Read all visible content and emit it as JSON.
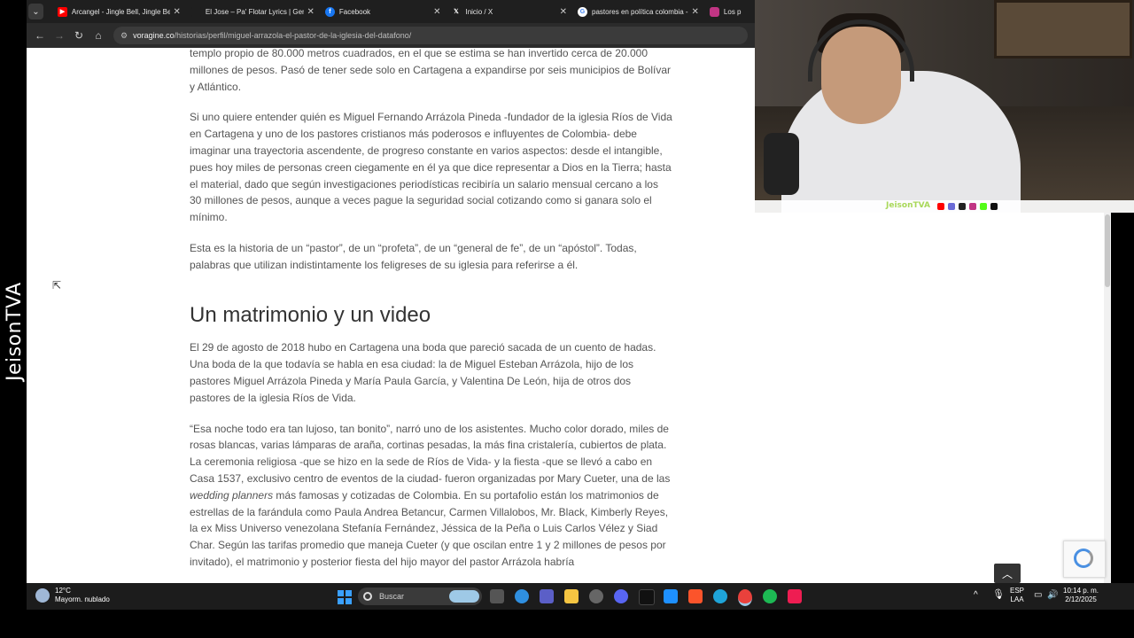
{
  "side_watermark": "JeisonTVA",
  "tabs": [
    {
      "title": "Arcangel - Jingle Bell, Jingle Be",
      "icon": "youtube-icon",
      "color": "#ff0000"
    },
    {
      "title": "El Jose – Pa' Flotar Lyrics | Geni",
      "icon": "genius-icon",
      "color": "#ffff64"
    },
    {
      "title": "Facebook",
      "icon": "facebook-icon",
      "color": "#1877f2"
    },
    {
      "title": "Inicio / X",
      "icon": "x-icon",
      "color": "#000000"
    },
    {
      "title": "pastores en política colombia -",
      "icon": "google-icon",
      "color": "#ffffff"
    },
    {
      "title": "Los p",
      "icon": "instagram-icon",
      "color": "#c13584"
    }
  ],
  "address_bar": {
    "domain": "voragine.co",
    "path": "/historias/perfil/miguel-arrazola-el-pastor-de-la-iglesia-del-datafono/"
  },
  "article": {
    "p0": "templo propio de 80.000 metros cuadrados, en el que se estima se han invertido cerca de 20.000 millones de pesos. Pasó de tener sede solo en Cartagena a expandirse por seis municipios de Bolívar y Atlántico.",
    "p1": "Si uno quiere entender quién es Miguel Fernando Arrázola Pineda -fundador de la iglesia Ríos de Vida en Cartagena y uno de los pastores cristianos más poderosos e influyentes de Colombia- debe imaginar una trayectoria ascendente, de progreso constante en varios aspectos: desde el intangible, pues hoy miles de personas creen ciegamente en él ya que dice representar a Dios en la Tierra; hasta el material, dado que según investigaciones periodísticas recibiría un salario mensual cercano a los 30 millones de pesos, aunque a veces pague la seguridad social cotizando como si ganara solo el mínimo.",
    "p2": "Esta es la historia de un “pastor”, de un “profeta”, de un “general de fe”, de un “apóstol”. Todas, palabras que utilizan indistintamente los feligreses de su iglesia para referirse a él.",
    "heading": "Un matrimonio y un video",
    "p3": "El 29 de agosto de 2018 hubo en Cartagena una boda que pareció sacada de un cuento de hadas. Una boda de la que todavía se habla en esa ciudad: la de Miguel Esteban Arrázola, hijo de los pastores Miguel Arrázola Pineda y María Paula García, y Valentina De León, hija de otros dos pastores de la iglesia Ríos de Vida.",
    "p4_a": "“Esa noche todo era tan lujoso, tan bonito”, narró uno de los asistentes. Mucho color dorado, miles de rosas blancas, varias lámparas de araña, cortinas pesadas, la más fina cristalería, cubiertos de plata. La ceremonia religiosa -que se hizo en la sede de Ríos de Vida- y la fiesta -que se llevó a cabo en Casa 1537, exclusivo centro de eventos de la ciudad- fueron organizadas por Mary Cueter, una de las ",
    "p4_em": "wedding planners",
    "p4_b": " más famosas y cotizadas de Colombia. En su portafolio están los matrimonios de estrellas de la farándula como Paula Andrea Betancur, Carmen Villalobos, Mr. Black, Kimberly Reyes, la ex Miss Universo venezolana Stefanía Fernández, Jéssica de la Peña o Luis Carlos Vélez y Siad Char. Según las tarifas promedio que maneja Cueter (y que oscilan entre 1 y 2 millones de pesos por invitado), el matrimonio y posterior fiesta del hijo mayor del pastor Arrázola habría"
  },
  "webcam": {
    "handle": "JeisonTVA"
  },
  "taskbar": {
    "weather_temp": "12°C",
    "weather_desc": "Mayorm. nublado",
    "search_placeholder": "Buscar",
    "lang_1": "ESP",
    "lang_2": "LAA",
    "time": "10:14 p. m.",
    "date": "2/12/2025"
  },
  "colors": {
    "windows_accent": "#3aa0ff",
    "handle_green": "#a9d85a"
  }
}
